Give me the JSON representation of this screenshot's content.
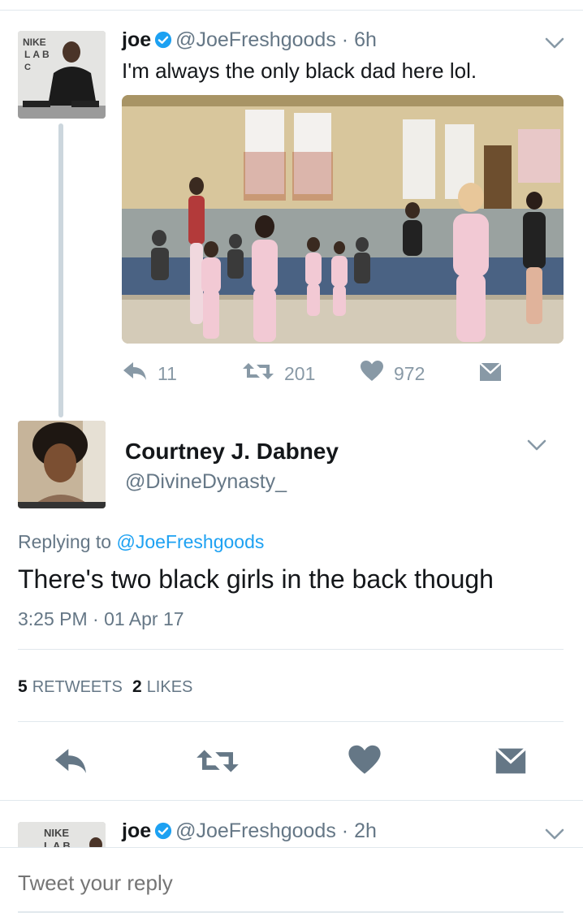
{
  "colors": {
    "accent": "#1da1f2",
    "secondary_text": "#657786",
    "icon_gray": "#8899a6",
    "divider": "#e1e8ed"
  },
  "parent_tweet": {
    "name": "joe",
    "handle": "@JoeFreshgoods",
    "time": "· 6h",
    "text": "I'm always the only black dad here lol.",
    "avatar_text": [
      "NIKE",
      "LAB",
      "C"
    ],
    "actions": {
      "reply_count": "11",
      "retweet_count": "201",
      "like_count": "972"
    },
    "icons": [
      "verified-icon",
      "chevron-down-icon",
      "reply-icon",
      "retweet-icon",
      "heart-icon",
      "dm-icon"
    ]
  },
  "main_tweet": {
    "name": "Courtney J. Dabney",
    "handle": "@DivineDynasty_",
    "replying_prefix": "Replying to",
    "replying_handle": "@JoeFreshgoods",
    "text": "There's two black girls in the back though",
    "timestamp": "3:25 PM · 01 Apr 17",
    "stats": {
      "retweets_count": "5",
      "retweets_label": "RETWEETS",
      "likes_count": "2",
      "likes_label": "LIKES"
    }
  },
  "next_tweet": {
    "name": "joe",
    "handle": "@JoeFreshgoods",
    "time": "· 2h",
    "avatar_text": [
      "NIKE",
      "LAB"
    ]
  },
  "compose": {
    "placeholder": "Tweet your reply"
  }
}
